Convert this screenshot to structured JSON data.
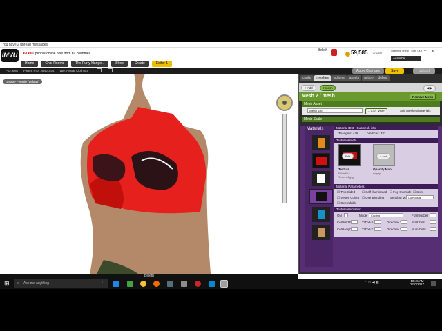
{
  "notification": "You have 2 unread messages",
  "logo": "IMVU",
  "header": {
    "online_count": "61,601",
    "online_text": "people online now from 69 countries",
    "username": "Beleth",
    "credits": "59,585",
    "credits_label": "credits",
    "links": "Settings | Help | Sign Out",
    "status": "Available"
  },
  "nav": [
    {
      "label": "Home"
    },
    {
      "label": "Chat Rooms"
    },
    {
      "label": "The Furry Hango..."
    },
    {
      "label": "Shop"
    },
    {
      "label": "Create"
    },
    {
      "label": "Editor 1"
    }
  ],
  "toolbar": {
    "pid": "PID: 80A",
    "parent_pid": "Parent PID: 28401934",
    "type": "Type: Avatar Clothing",
    "apply_label": "Apply Changes",
    "save_label": "Save",
    "upload_label": "Upload"
  },
  "scene": {
    "display_label": "Display Female (default)",
    "bottom_name": "Beleth"
  },
  "panel": {
    "tabs": [
      "config",
      "meshes",
      "actions",
      "assets",
      "action",
      "debug"
    ],
    "active_tab": "meshes",
    "add_label": "+ Add",
    "mesh_tab": "2 mesh",
    "mesh_title": "Mesh 2 / mesh",
    "remove_mesh": "Remove Mesh",
    "mesh_asset": "Mesh Asset",
    "mesh_select": "mesh 2/IIf",
    "add_xmf": "+ Add .XMF",
    "sub_mesh": "Sub Meshes/Materials",
    "mesh_scale": "Mesh Scale",
    "materials": "Materials",
    "material_header": "Material ID 3 - Submesh info",
    "triangles": "Triangles: 426",
    "vertices": "Vertices: 337",
    "texture_assets": "Texture Assets",
    "edit_label": "Edit",
    "add_label2": "+ Add",
    "texture_label": "Texture",
    "texture_id": "EY9x8Y4",
    "texture_file": "Texture4.jpg",
    "opacity_label": "Opacity Map",
    "opacity_val": "empty",
    "material_params": "Material Parameters",
    "params": [
      "Two Sided",
      "Self Illuminated",
      "Fog Override",
      "Skin Composite",
      "Vertex Colors",
      "Use Blending",
      "Blending Mode",
      "Overridable"
    ],
    "blend_mode": "Composite",
    "texture_anim": "Texture Animation",
    "anim_fields": [
      "ON",
      "Mode",
      "Cycling",
      "Frames/Cell",
      "Cell Width",
      "X/Tpd-S",
      "Direction X",
      "Start Cell",
      "Cell Height",
      "X/Tpd-T",
      "Direction Y",
      "Num Cells"
    ]
  },
  "taskbar": {
    "search": "Ask me anything",
    "time": "10:45 AM",
    "date": "2/10/2017"
  }
}
